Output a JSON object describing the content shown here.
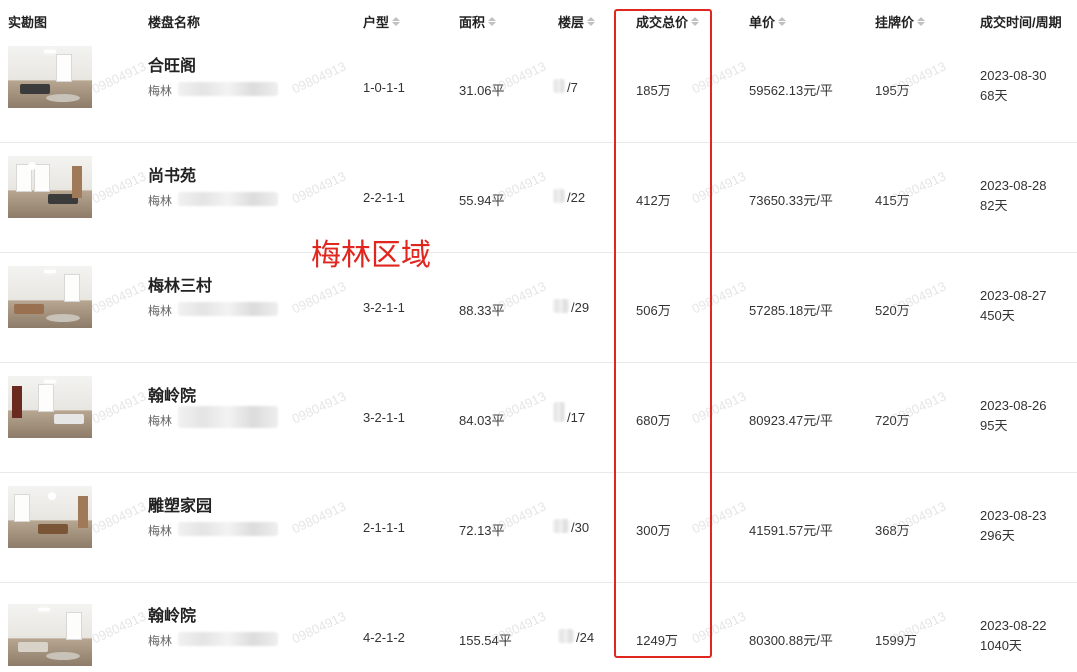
{
  "headers": {
    "photo": "实勘图",
    "name": "楼盘名称",
    "layout": "户型",
    "area": "面积",
    "floor": "楼层",
    "total_price": "成交总价",
    "unit_price": "单价",
    "list_price": "挂牌价",
    "deal_time": "成交时间/周期"
  },
  "annotation": "梅林区域",
  "watermark_text": "09804913",
  "rows": [
    {
      "name": "合旺阁",
      "district": "梅林",
      "layout": "1-0-1-1",
      "area": "31.06平",
      "floor": "/7",
      "total": "185万",
      "unit": "59562.13元/平",
      "listing": "195万",
      "date": "2023-08-30",
      "cycle": "68天"
    },
    {
      "name": "尚书苑",
      "district": "梅林",
      "layout": "2-2-1-1",
      "area": "55.94平",
      "floor": "/22",
      "total": "412万",
      "unit": "73650.33元/平",
      "listing": "415万",
      "date": "2023-08-28",
      "cycle": "82天"
    },
    {
      "name": "梅林三村",
      "district": "梅林",
      "layout": "3-2-1-1",
      "area": "88.33平",
      "floor": "/29",
      "total": "506万",
      "unit": "57285.18元/平",
      "listing": "520万",
      "date": "2023-08-27",
      "cycle": "450天"
    },
    {
      "name": "翰岭院",
      "district": "梅林",
      "layout": "3-2-1-1",
      "area": "84.03平",
      "floor": "/17",
      "total": "680万",
      "unit": "80923.47元/平",
      "listing": "720万",
      "date": "2023-08-26",
      "cycle": "95天"
    },
    {
      "name": "雕塑家园",
      "district": "梅林",
      "layout": "2-1-1-1",
      "area": "72.13平",
      "floor": "/30",
      "total": "300万",
      "unit": "41591.57元/平",
      "listing": "368万",
      "date": "2023-08-23",
      "cycle": "296天"
    },
    {
      "name": "翰岭院",
      "district": "梅林",
      "layout": "4-2-1-2",
      "area": "155.54平",
      "floor": "/24",
      "total": "1249万",
      "unit": "80300.88元/平",
      "listing": "1599万",
      "date": "2023-08-22",
      "cycle": "1040天"
    }
  ],
  "colors": {
    "highlight": "#e0261e",
    "border": "#e9e9e9"
  }
}
